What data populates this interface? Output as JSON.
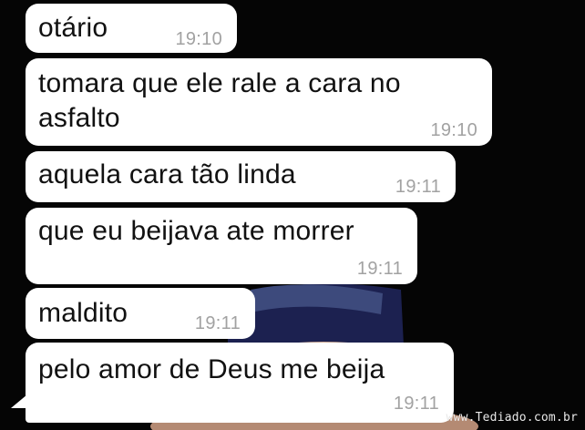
{
  "conversation": {
    "messages": [
      {
        "text_lines": [
          "otário"
        ],
        "time": "19:10"
      },
      {
        "text_lines": [
          "tomara que ele rale a cara no",
          "asfalto"
        ],
        "time": "19:10"
      },
      {
        "text_lines": [
          "aquela cara tão linda"
        ],
        "time": "19:11"
      },
      {
        "text_lines": [
          "que eu beijava ate morrer"
        ],
        "time": "19:11"
      },
      {
        "text_lines": [
          "maldito"
        ],
        "time": "19:11"
      },
      {
        "text_lines": [
          "pelo amor de Deus me beija"
        ],
        "time": "19:11"
      }
    ]
  },
  "watermark": {
    "text": "www.Tediado.com.br"
  },
  "colors": {
    "bubble": "#ffffff",
    "time": "#a2a2a2",
    "background": "#050505"
  }
}
